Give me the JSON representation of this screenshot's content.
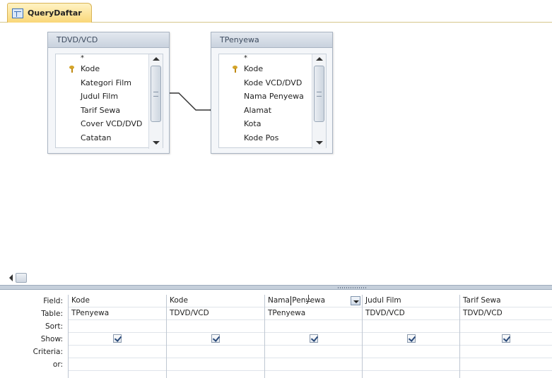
{
  "tab": {
    "label": "QueryDaftar"
  },
  "tables": [
    {
      "title": "TDVD/VCD",
      "fields": [
        "*",
        "Kode",
        "Kategori Film",
        "Judul Film",
        "Tarif Sewa",
        "Cover VCD/DVD",
        "Catatan"
      ],
      "primary_key": "Kode"
    },
    {
      "title": "TPenyewa",
      "fields": [
        "*",
        "Kode",
        "Kode VCD/DVD",
        "Nama Penyewa",
        "Alamat",
        "Kota",
        "Kode Pos"
      ],
      "primary_key": "Kode"
    }
  ],
  "grid": {
    "row_labels": [
      "Field:",
      "Table:",
      "Sort:",
      "Show:",
      "Criteria:",
      "or:"
    ],
    "columns": [
      {
        "field": "Kode",
        "table": "TPenyewa",
        "sort": "",
        "show": true,
        "criteria": "",
        "or": ""
      },
      {
        "field": "Kode",
        "table": "TDVD/VCD",
        "sort": "",
        "show": true,
        "criteria": "",
        "or": ""
      },
      {
        "field": "Nama Penyewa",
        "table": "TPenyewa",
        "sort": "",
        "show": true,
        "criteria": "",
        "or": ""
      },
      {
        "field": "Judul Film",
        "table": "TDVD/VCD",
        "sort": "",
        "show": true,
        "criteria": "",
        "or": ""
      },
      {
        "field": "Tarif Sewa",
        "table": "TDVD/VCD",
        "sort": "",
        "show": true,
        "criteria": "",
        "or": ""
      }
    ]
  },
  "colors": {
    "tab": "#f9d779",
    "splitter": "#c5cfdb",
    "table_header": "#c9d2de"
  }
}
